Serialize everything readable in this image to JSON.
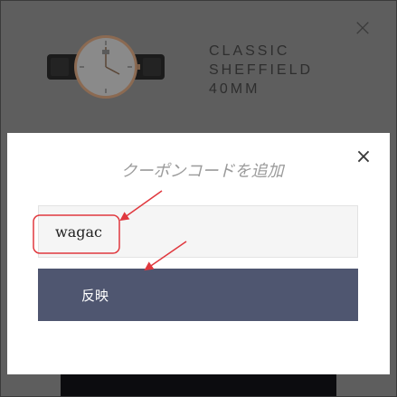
{
  "background": {
    "product_name": "CLASSIC\nSHEFFIELD\n40MM",
    "close_glyph": "×"
  },
  "modal": {
    "title": "クーポンコードを追加",
    "close_glyph": "×",
    "coupon_input_value": "wagac",
    "apply_label": "反映"
  },
  "colors": {
    "overlay": "#5e5e5e",
    "modal_bg": "#ffffff",
    "button_bg": "#4f5670",
    "annotation": "#e0383e"
  },
  "icons": [
    "close-icon",
    "watch-image"
  ]
}
